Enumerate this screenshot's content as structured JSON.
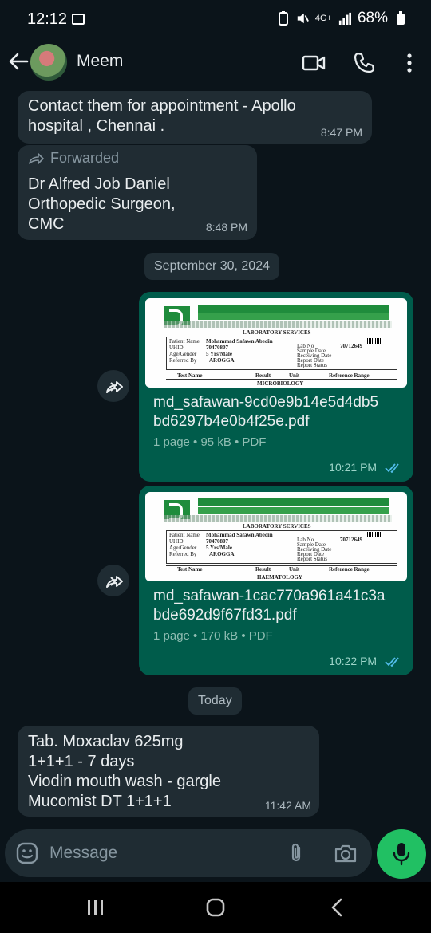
{
  "status_bar": {
    "time": "12:12",
    "network_label": "4G+",
    "battery_percent": "68%"
  },
  "header": {
    "contact_name": "Meem"
  },
  "messages": [
    {
      "type": "incoming",
      "text_lines": [
        "Contact them for appointment - Apollo",
        "hospital , Chennai ."
      ],
      "time": "8:47 PM"
    },
    {
      "type": "incoming",
      "forwarded_label": "Forwarded",
      "text_lines": [
        "Dr Alfred Job Daniel",
        "Orthopedic Surgeon,",
        "CMC"
      ],
      "time": "8:48 PM"
    },
    {
      "type": "date",
      "label": "September 30, 2024"
    },
    {
      "type": "outgoing-file",
      "file_name_lines": [
        "md_safawan-9cd0e9b14e5d4db5",
        "bd6297b4e0b4f25e.pdf"
      ],
      "meta": "1 page • 95 kB • PDF",
      "time": "10:21 PM",
      "preview": {
        "section": "LABORATORY SERVICES",
        "patient_name": "Mohammad Safawn Abedin",
        "uhid": "70470807",
        "age_gender": "5 Yrs/Male",
        "referred_by": "AROGGA",
        "lab_no": "70712649",
        "department": "MICROBIOLOGY"
      }
    },
    {
      "type": "outgoing-file",
      "file_name_lines": [
        "md_safawan-1cac770a961a41c3a",
        "bde692d9f67fd31.pdf"
      ],
      "meta": "1 page • 170 kB • PDF",
      "time": "10:22 PM",
      "preview": {
        "section": "LABORATORY SERVICES",
        "patient_name": "Mohammad Safawn Abedin",
        "uhid": "70470807",
        "age_gender": "5 Yrs/Male",
        "referred_by": "AROGGA",
        "lab_no": "70712649",
        "department": "HAEMATOLOGY"
      }
    },
    {
      "type": "date",
      "label": "Today"
    },
    {
      "type": "incoming",
      "text_lines": [
        "Tab. Moxaclav 625mg",
        "1+1+1 - 7 days",
        "Viodin mouth wash - gargle",
        "Mucomist DT 1+1+1"
      ],
      "time": "11:42 AM"
    }
  ],
  "pdf_labels": {
    "patient_name": "Patient Name",
    "uhid": "UHID",
    "age_gender": "Age/Gender",
    "referred_by": "Referred By",
    "lab_no": "Lab No",
    "sample_date": "Sample Date",
    "receiving_date": "Receiving Date",
    "report_date": "Report Date",
    "report_status": "Report Status",
    "col_test": "Test Name",
    "col_result": "Result",
    "col_unit": "Unit",
    "col_range": "Reference Range"
  },
  "composer": {
    "placeholder": "Message"
  },
  "colors": {
    "background": "#0b141a",
    "incoming_bubble": "#202c33",
    "outgoing_bubble": "#005c4b",
    "accent_green": "#21c063",
    "read_ticks": "#53bdeb"
  },
  "icons": [
    "back-arrow-icon",
    "video-call-icon",
    "voice-call-icon",
    "more-options-icon",
    "forward-icon",
    "share-icon",
    "emoji-icon",
    "attach-icon",
    "camera-icon",
    "mic-icon"
  ]
}
